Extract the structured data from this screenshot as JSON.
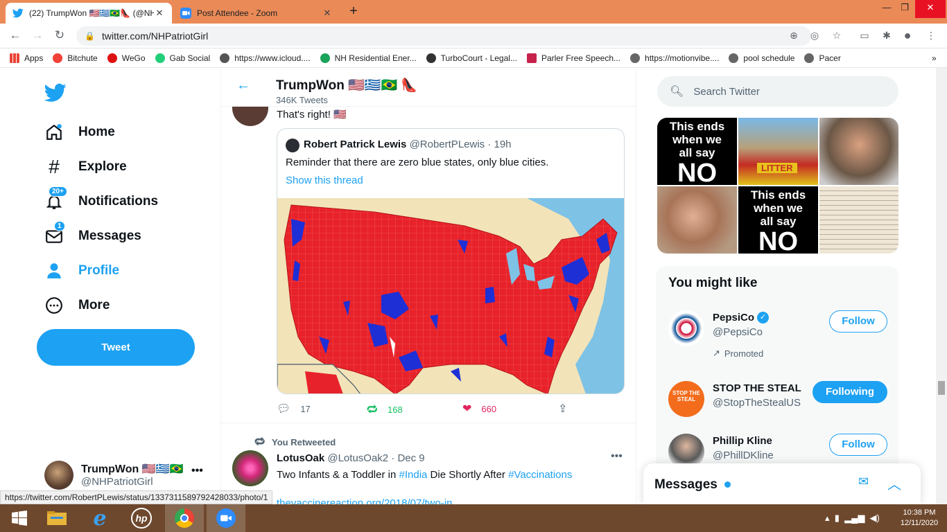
{
  "browser": {
    "tabs": [
      {
        "title": "(22) TrumpWon 🇺🇸🇬🇷🇧🇷👠 (@NH",
        "active": true
      },
      {
        "title": "Post Attendee - Zoom",
        "active": false
      }
    ],
    "url": "twitter.com/NHPatriotGirl",
    "bookmarks": [
      "Apps",
      "Bitchute",
      "WeGo",
      "Gab Social",
      "https://www.icloud....",
      "NH Residential Ener...",
      "TurboCourt - Legal...",
      "Parler Free Speech...",
      "https://motionvibe....",
      "pool schedule",
      "Pacer"
    ],
    "status_url": "https://twitter.com/RobertPLewis/status/1337311589792428033/photo/1"
  },
  "nav": {
    "items": [
      {
        "label": "Home",
        "icon": "home-icon"
      },
      {
        "label": "Explore",
        "icon": "hashtag-icon"
      },
      {
        "label": "Notifications",
        "icon": "bell-icon",
        "badge": "20+"
      },
      {
        "label": "Messages",
        "icon": "mail-icon",
        "badge": "1"
      },
      {
        "label": "Profile",
        "icon": "person-icon",
        "active": true
      },
      {
        "label": "More",
        "icon": "more-circle-icon"
      }
    ],
    "tweet_button": "Tweet",
    "account": {
      "name": "TrumpWon 🇺🇸🇬🇷🇧🇷",
      "handle": "@NHPatriotGirl",
      "more": "•••"
    }
  },
  "header": {
    "title": "TrumpWon 🇺🇸🇬🇷🇧🇷 👠",
    "subtitle": "346K Tweets"
  },
  "tweet1": {
    "text": "That's right! 🇺🇸",
    "quote": {
      "name": "Robert Patrick Lewis",
      "handle": "@RobertPLewis · 19h",
      "text": "Reminder that there are zero blue states, only blue cities.",
      "link": "Show this thread"
    },
    "replies": "17",
    "retweets": "168",
    "likes": "660"
  },
  "tweet2": {
    "retweet_label": "You Retweeted",
    "name": "LotusOak",
    "handle": "@LotusOak2 · Dec 9",
    "text_before": "Two Infants & a Toddler in ",
    "tag1": "#India",
    "text_mid": " Die Shortly After ",
    "tag2": "#Vaccinations",
    "link": "thevaccinereaction.org/2018/07/two-in..."
  },
  "right": {
    "search_placeholder": "Search Twitter",
    "media": [
      {
        "type": "text",
        "lines": [
          "This ends",
          "when we",
          "all say"
        ],
        "big": "NO"
      },
      {
        "type": "image",
        "label": "LITTER"
      },
      {
        "type": "image"
      },
      {
        "type": "image"
      },
      {
        "type": "text",
        "lines": [
          "This ends",
          "when we",
          "all say"
        ],
        "big": "NO"
      },
      {
        "type": "image"
      }
    ],
    "wtf_title": "You might like",
    "suggestions": [
      {
        "name": "PepsiCo",
        "handle": "@PepsiCo",
        "verified": true,
        "promoted": "Promoted",
        "button": "Follow",
        "following": false
      },
      {
        "name": "STOP THE STEAL",
        "handle": "@StopTheStealUS",
        "avatar_text": "STOP THE STEAL",
        "button": "Following",
        "following": true
      },
      {
        "name": "Phillip Kline",
        "handle": "@PhillDKline",
        "button": "Follow",
        "following": false
      }
    ]
  },
  "messages_dock": {
    "title": "Messages"
  },
  "taskbar": {
    "time": "10:38 PM",
    "date": "12/11/2020"
  },
  "colors": {
    "accent": "#1da1f2",
    "like": "#e0245e",
    "retweet": "#17bf63",
    "chrome": "#ea8a57",
    "taskbar": "#6e482d"
  }
}
